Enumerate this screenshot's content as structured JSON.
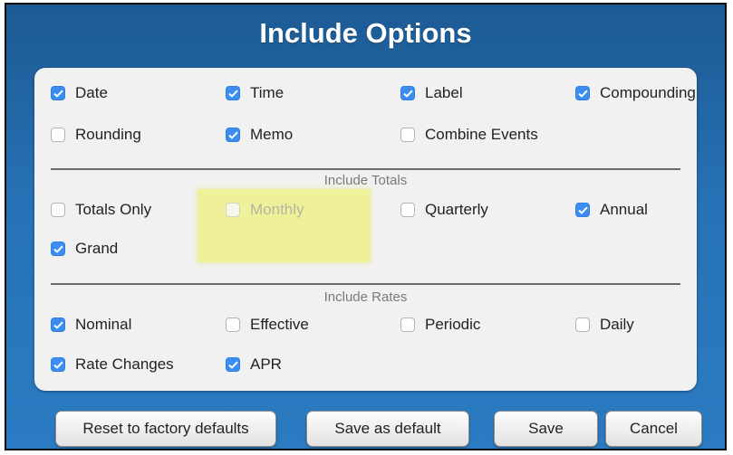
{
  "dialog": {
    "title": "Include Options"
  },
  "options": [
    {
      "label": "Date",
      "checked": true
    },
    {
      "label": "Time",
      "checked": true
    },
    {
      "label": "Label",
      "checked": true
    },
    {
      "label": "Compounding",
      "checked": true
    },
    {
      "label": "Rounding",
      "checked": false
    },
    {
      "label": "Memo",
      "checked": true
    },
    {
      "label": "Combine Events",
      "checked": false
    }
  ],
  "totals": {
    "title": "Include Totals",
    "items": [
      {
        "label": "Totals Only",
        "checked": false
      },
      {
        "label": "Monthly",
        "checked": false,
        "disabled": true
      },
      {
        "label": "Quarterly",
        "checked": false
      },
      {
        "label": "Annual",
        "checked": true
      },
      {
        "label": "Grand",
        "checked": true
      }
    ]
  },
  "rates": {
    "title": "Include Rates",
    "items": [
      {
        "label": "Nominal",
        "checked": true
      },
      {
        "label": "Effective",
        "checked": false
      },
      {
        "label": "Periodic",
        "checked": false
      },
      {
        "label": "Daily",
        "checked": false
      },
      {
        "label": "Rate Changes",
        "checked": true
      },
      {
        "label": "APR",
        "checked": true
      }
    ]
  },
  "buttons": {
    "reset": "Reset to factory defaults",
    "save_default": "Save as default",
    "save": "Save",
    "cancel": "Cancel"
  },
  "colors": {
    "accent": "#3b8df2",
    "dialog_background": "#2772b6",
    "highlight": "#eef28a"
  }
}
